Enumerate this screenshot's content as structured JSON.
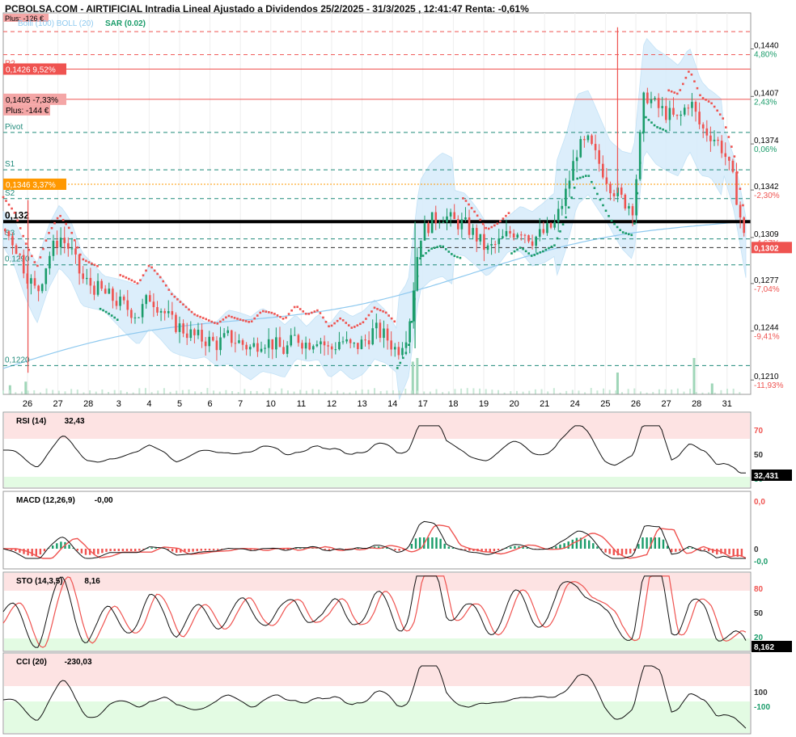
{
  "header": {
    "title": "PCBOLSA.COM - AIRTIFICIAL Intradia Lineal Ajustado a Dividendos 25/2/2025 - 31/3/2025 , 12:41:47 Renta: -0,61%",
    "overlay_text": "Plus: -126 €",
    "legend_bb": "Bolli (100) BOLL (20)",
    "legend_sar": "SAR (0.02)"
  },
  "colors": {
    "up": "#1a9c6a",
    "down": "#ef5350",
    "sar_up": "#1a9c6a",
    "sar_down": "#ef5350",
    "band": "#d7ecfb",
    "ma": "#8ec9ef",
    "grid": "#dddddd"
  },
  "price_panel": {
    "levels": [
      {
        "name": "R2",
        "price": 0.1426,
        "label": "R2",
        "badge": "0,1426  9,52%",
        "badge_color": "#ef5350",
        "style": "solid",
        "color": "#ef5350"
      },
      {
        "name": "entry",
        "price": 0.1405,
        "badge": "0,1405  -7,33%",
        "badge2": "Plus: -144 €",
        "badge_color": "#f4a6a6",
        "style": "solid",
        "color": "#ef5350"
      },
      {
        "name": "Pivot",
        "price": 0.1382,
        "label": "Pivot",
        "style": "dashed",
        "color": "#1f8a7a"
      },
      {
        "name": "S1",
        "price": 0.1356,
        "label": "S1",
        "style": "dashed",
        "color": "#1f8a7a"
      },
      {
        "name": "orange",
        "price": 0.1346,
        "badge": "0,1346  3,37%",
        "badge_color": "#ff9800",
        "style": "dotted",
        "color": "#ff9800"
      },
      {
        "name": "S2",
        "price": 0.1336,
        "label": "S2",
        "style": "dashed",
        "color": "#1f8a7a"
      },
      {
        "name": "heavy",
        "price": 0.132,
        "label": "0,132",
        "style": "heavy",
        "color": "#000000"
      },
      {
        "name": "S3",
        "price": 0.1308,
        "label": "S3",
        "style": "dashed",
        "color": "#1f8a7a"
      },
      {
        "name": "current",
        "price": 0.1302,
        "style": "dashed",
        "color": "#333333"
      },
      {
        "name": "low",
        "price": 0.129,
        "label": "0,1290",
        "style": "dashed",
        "color": "#1f8a7a"
      },
      {
        "name": "bottom",
        "price": 0.122,
        "label": "0,1220",
        "style": "dashed",
        "color": "#1f8a7a"
      },
      {
        "name": "top",
        "price": 0.1452,
        "style": "dashed",
        "color": "#ef5350"
      },
      {
        "name": "r1",
        "price": 0.1436,
        "style": "dashed",
        "color": "#ef5350"
      }
    ],
    "right_axis": [
      {
        "price": 0.144,
        "value": "0,1440",
        "pct": "4,80%",
        "pct_color": "#1a9c6a"
      },
      {
        "price": 0.1407,
        "value": "0,1407",
        "pct": "2,43%",
        "pct_color": "#1a9c6a"
      },
      {
        "price": 0.1374,
        "value": "0,1374",
        "pct": "0,06%",
        "pct_color": "#1a9c6a"
      },
      {
        "price": 0.1342,
        "value": "0,1342",
        "pct": "-2,30%",
        "pct_color": "#ef5350"
      },
      {
        "price": 0.1309,
        "value": "0,1309",
        "pct": "-4,67%",
        "pct_color": "#ef5350"
      },
      {
        "price": 0.1277,
        "value": "0,1277",
        "pct": "-7,04%",
        "pct_color": "#ef5350"
      },
      {
        "price": 0.1244,
        "value": "0,1244",
        "pct": "-9,41%",
        "pct_color": "#ef5350"
      },
      {
        "price": 0.121,
        "value": "0,1210",
        "pct": "-11,93%",
        "pct_color": "#ef5350"
      }
    ],
    "current_badge": "0,1302",
    "x_labels": [
      "26",
      "27",
      "28",
      "3",
      "4",
      "5",
      "6",
      "7",
      "10",
      "11",
      "12",
      "13",
      "14",
      "17",
      "18",
      "19",
      "20",
      "21",
      "24",
      "25",
      "26",
      "27",
      "28",
      "31"
    ]
  },
  "chart_data": [
    {
      "type": "candlestick",
      "title": "AIRTIFICIAL Intradia",
      "x": [
        "26",
        "27",
        "28",
        "3",
        "4",
        "5",
        "6",
        "7",
        "10",
        "11",
        "12",
        "13",
        "14",
        "17",
        "18",
        "19",
        "20",
        "21",
        "24",
        "25",
        "26",
        "27",
        "28",
        "31"
      ],
      "ylim": [
        0.12,
        0.1465
      ],
      "close_path": [
        [
          0,
          0.1315
        ],
        [
          0.5,
          0.1305
        ],
        [
          1,
          0.1285
        ],
        [
          1.5,
          0.127
        ],
        [
          2,
          0.1295
        ],
        [
          2.5,
          0.131
        ],
        [
          3,
          0.13
        ],
        [
          3.5,
          0.128
        ],
        [
          4,
          0.1275
        ],
        [
          4.5,
          0.127
        ],
        [
          5,
          0.1265
        ],
        [
          5.5,
          0.126
        ],
        [
          6,
          0.1255
        ],
        [
          6.5,
          0.1268
        ],
        [
          7,
          0.126
        ],
        [
          7.5,
          0.125
        ],
        [
          8,
          0.1245
        ],
        [
          8.5,
          0.124
        ],
        [
          9,
          0.1238
        ],
        [
          9.5,
          0.1235
        ],
        [
          10,
          0.124
        ],
        [
          10.5,
          0.1236
        ],
        [
          11,
          0.1232
        ],
        [
          11.5,
          0.1238
        ],
        [
          12,
          0.1235
        ],
        [
          12.5,
          0.123
        ],
        [
          13,
          0.124
        ],
        [
          13.5,
          0.1235
        ],
        [
          14,
          0.124
        ],
        [
          14.5,
          0.123
        ],
        [
          15,
          0.1238
        ],
        [
          15.5,
          0.1232
        ],
        [
          16,
          0.1236
        ],
        [
          16.5,
          0.1245
        ],
        [
          17,
          0.124
        ],
        [
          17.5,
          0.123
        ],
        [
          18,
          0.1245
        ],
        [
          18.5,
          0.131
        ],
        [
          19,
          0.132
        ],
        [
          19.5,
          0.1325
        ],
        [
          20,
          0.132
        ],
        [
          20.5,
          0.1318
        ],
        [
          21,
          0.131
        ],
        [
          21.5,
          0.13
        ],
        [
          22,
          0.1305
        ],
        [
          22.5,
          0.1312
        ],
        [
          23,
          0.1315
        ],
        [
          23.5,
          0.1308
        ],
        [
          24,
          0.1312
        ],
        [
          24.5,
          0.1318
        ],
        [
          25,
          0.134
        ],
        [
          25.5,
          0.137
        ],
        [
          26,
          0.1375
        ],
        [
          26.5,
          0.136
        ],
        [
          27,
          0.1345
        ],
        [
          27.5,
          0.1335
        ],
        [
          28,
          0.133
        ],
        [
          28.5,
          0.141
        ],
        [
          29,
          0.14
        ],
        [
          29.5,
          0.1395
        ],
        [
          30,
          0.139
        ],
        [
          30.5,
          0.1405
        ],
        [
          31,
          0.1385
        ],
        [
          31.5,
          0.138
        ],
        [
          32,
          0.137
        ],
        [
          32.5,
          0.1345
        ],
        [
          33,
          0.1302
        ]
      ],
      "volume_spikes": [
        [
          0.3,
          0.25
        ],
        [
          1,
          0.35
        ],
        [
          18.2,
          0.9
        ],
        [
          18.4,
          1.0
        ],
        [
          27.3,
          0.6
        ],
        [
          30.7,
          1.0
        ],
        [
          31.5,
          0.3
        ]
      ],
      "rsi": {
        "label": "RSI (14)",
        "value": "32,43",
        "current": "32,431",
        "levels": [
          "70",
          "50",
          "30"
        ]
      },
      "macd": {
        "label": "MACD (12,26,9)",
        "value": "-0,00",
        "levels": [
          "0,0",
          "0",
          "-0,0"
        ]
      },
      "sto": {
        "label": "STO (14,3,5)",
        "value": "8,16",
        "current": "8,162",
        "levels": [
          "80",
          "50",
          "20"
        ]
      },
      "cci": {
        "label": "CCI (20)",
        "value": "-230,03",
        "levels": [
          "100",
          "-100"
        ]
      }
    }
  ]
}
